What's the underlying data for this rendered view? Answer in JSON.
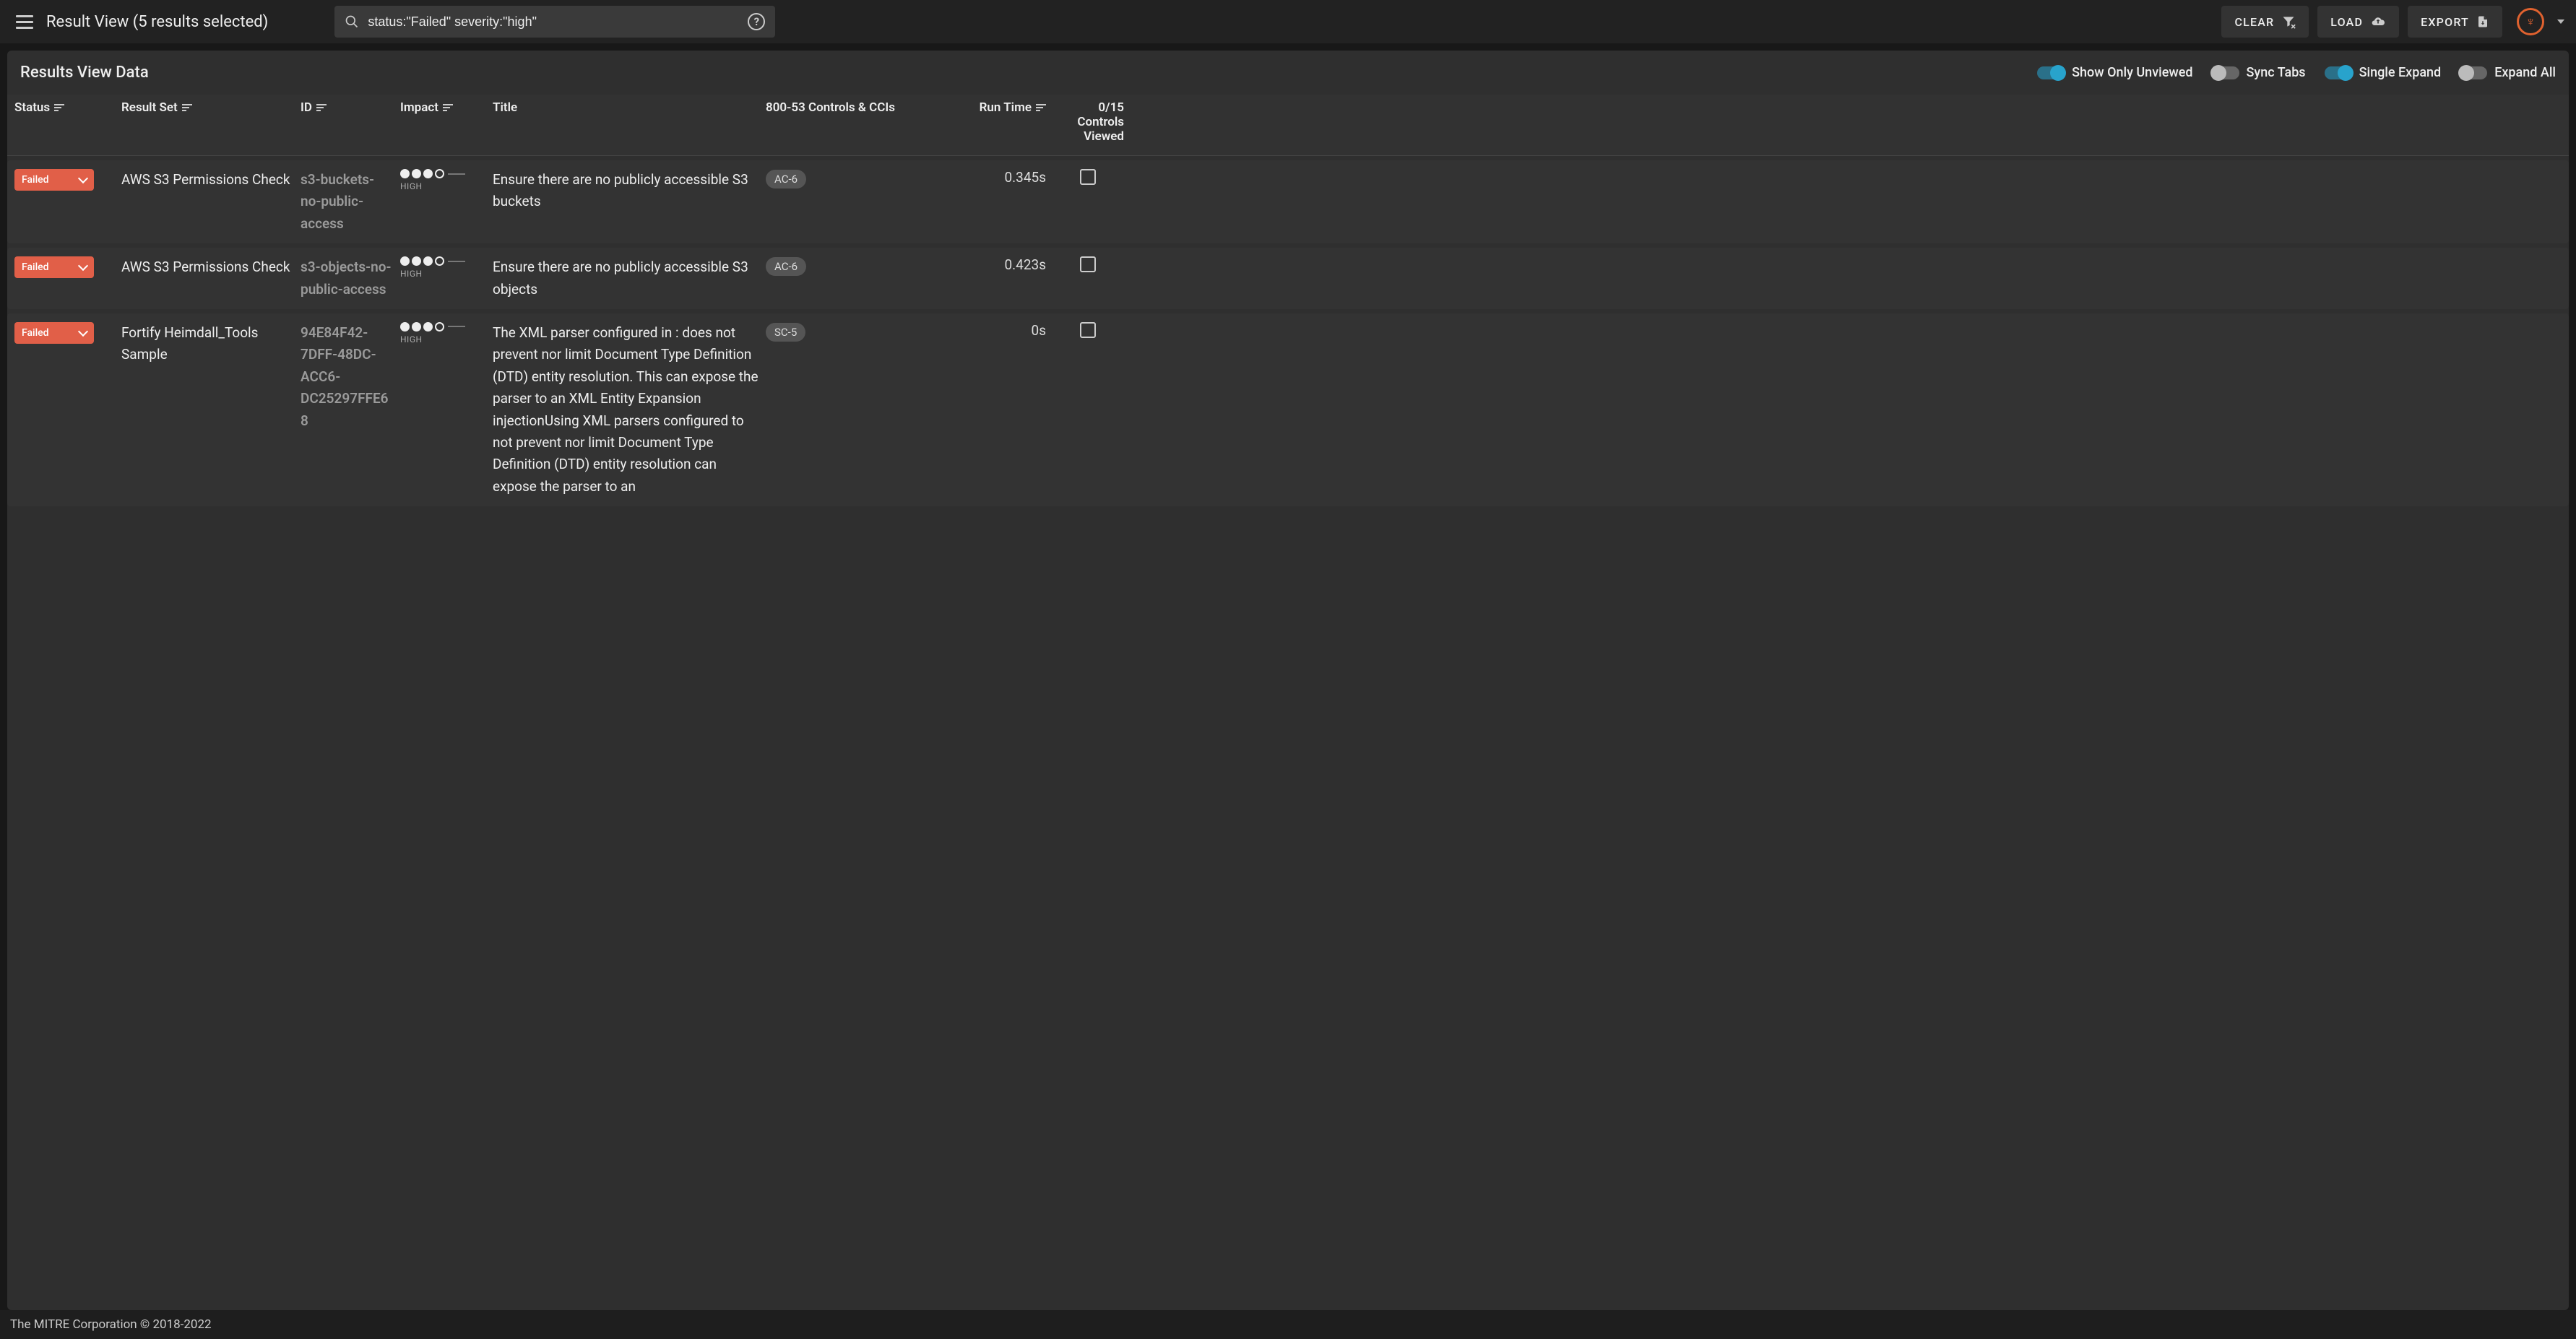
{
  "appbar": {
    "title": "Result View (5 results selected)",
    "search_value": "status:\"Failed\" severity:\"high\"",
    "clear_label": "CLEAR",
    "load_label": "LOAD",
    "export_label": "EXPORT"
  },
  "panel": {
    "title": "Results View Data",
    "toggles": {
      "show_only_unviewed": {
        "label": "Show Only Unviewed",
        "on": true
      },
      "sync_tabs": {
        "label": "Sync Tabs",
        "on": false
      },
      "single_expand": {
        "label": "Single Expand",
        "on": true
      },
      "expand_all": {
        "label": "Expand All",
        "on": false
      }
    }
  },
  "columns": {
    "status": "Status",
    "result_set": "Result Set",
    "id": "ID",
    "impact": "Impact",
    "title": "Title",
    "controls": "800-53 Controls & CCIs",
    "runtime": "Run Time",
    "viewed": "0/15 Controls Viewed"
  },
  "rows": [
    {
      "status": "Failed",
      "result_set": "AWS S3 Permissions Check",
      "id": "s3-buckets-no-public-access",
      "impact": "HIGH",
      "title": "Ensure there are no publicly accessible S3 buckets",
      "controls": "AC-6",
      "runtime": "0.345s"
    },
    {
      "status": "Failed",
      "result_set": "AWS S3 Permissions Check",
      "id": "s3-objects-no-public-access",
      "impact": "HIGH",
      "title": "Ensure there are no publicly accessible S3 objects",
      "controls": "AC-6",
      "runtime": "0.423s"
    },
    {
      "status": "Failed",
      "result_set": "Fortify Heimdall_Tools Sample",
      "id": "94E84F42-7DFF-48DC-ACC6-DC25297FFE68",
      "impact": "HIGH",
      "title": "The XML parser configured in : does not prevent nor limit Document Type Definition (DTD) entity resolution. This can expose the parser to an XML Entity Expansion injectionUsing XML parsers configured to not prevent nor limit Document Type Definition (DTD) entity resolution can expose the parser to an",
      "controls": "SC-5",
      "runtime": "0s"
    }
  ],
  "footer": "The MITRE Corporation © 2018-2022"
}
